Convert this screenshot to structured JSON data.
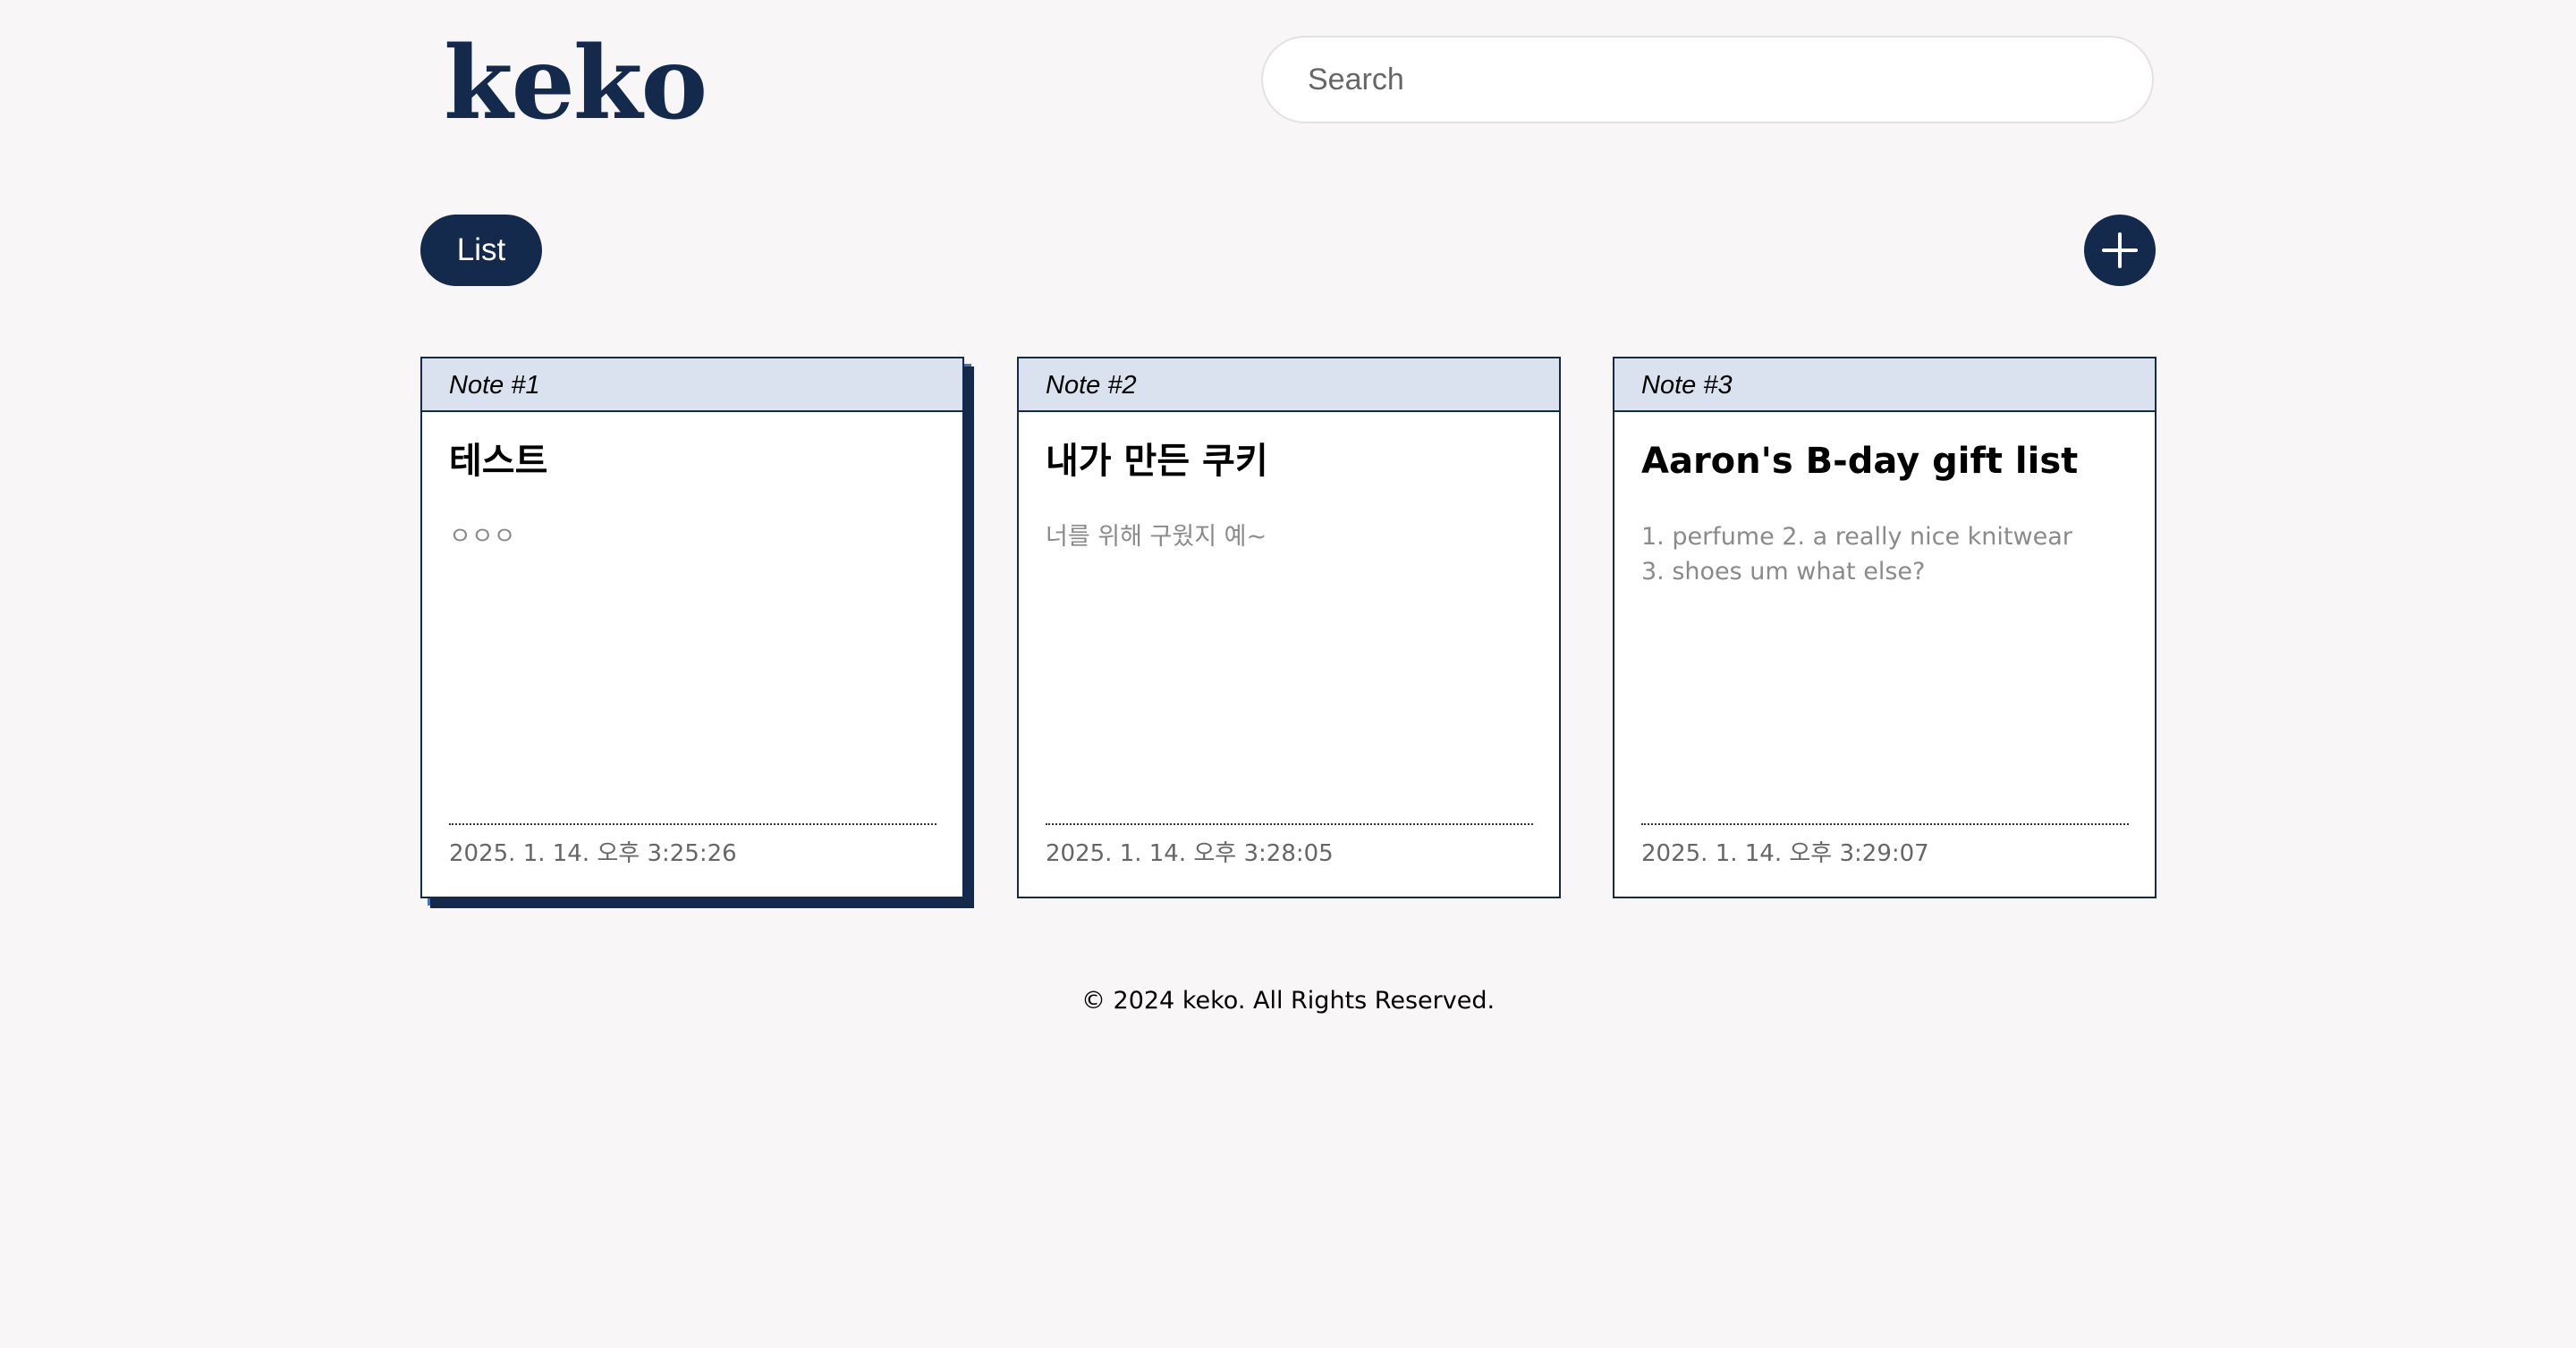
{
  "header": {
    "logo_text": "keko",
    "search_placeholder": "Search"
  },
  "toolbar": {
    "list_label": "List",
    "add_icon": "plus-icon"
  },
  "notes": [
    {
      "label": "Note #1",
      "title": "테스트",
      "body": "ㅇㅇㅇ",
      "date": "2025. 1. 14. 오후 3:25:26",
      "selected": true
    },
    {
      "label": "Note #2",
      "title": "내가 만든 쿠키",
      "body": "너를 위해 구웠지 예~",
      "date": "2025. 1. 14. 오후 3:28:05",
      "selected": false
    },
    {
      "label": "Note #3",
      "title": "Aaron's B-day gift list",
      "body": "1. perfume 2. a really nice knitwear 3. shoes um what else?",
      "date": "2025. 1. 14. 오후 3:29:07",
      "selected": false
    }
  ],
  "footer": {
    "copyright": "© 2024 keko. All Rights Reserved."
  },
  "colors": {
    "navy": "#132a4c",
    "note_header": "#dbe2ef",
    "shadow_accent": "#4672b6",
    "background": "#f8f6f7"
  }
}
